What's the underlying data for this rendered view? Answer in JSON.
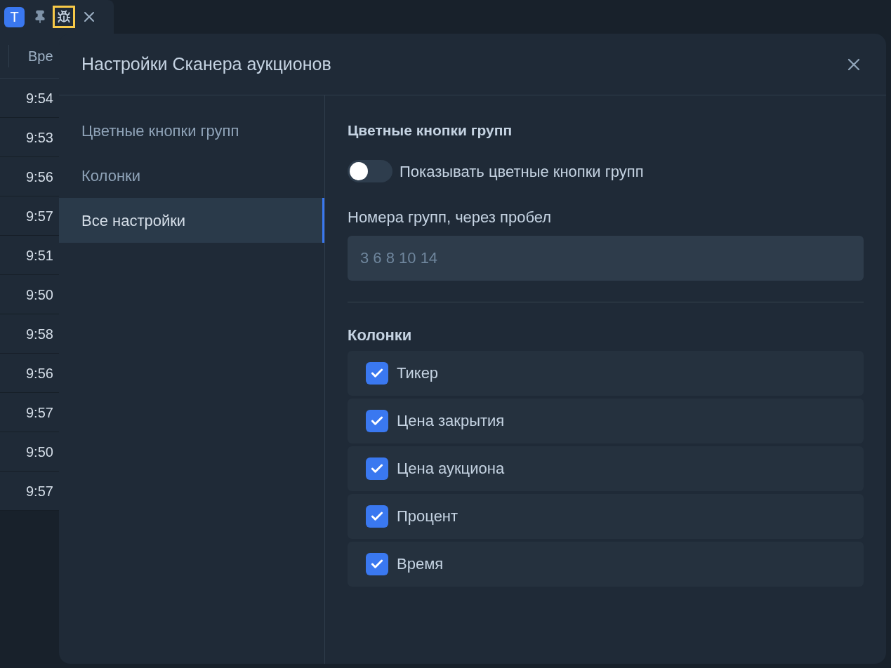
{
  "toolbar": {
    "badge": "T"
  },
  "table": {
    "column_header": "Вре",
    "rows": [
      "9:54",
      "9:53",
      "9:56",
      "9:57",
      "9:51",
      "9:50",
      "9:58",
      "9:56",
      "9:57",
      "9:50",
      "9:57"
    ]
  },
  "dialog": {
    "title": "Настройки Сканера аукционов",
    "sidebar": {
      "items": [
        {
          "label": "Цветные кнопки групп",
          "selected": false
        },
        {
          "label": "Колонки",
          "selected": false
        },
        {
          "label": "Все настройки",
          "selected": true
        }
      ]
    },
    "group_section": {
      "heading": "Цветные кнопки групп",
      "toggle": {
        "label": "Показывать цветные кнопки групп",
        "on": false
      },
      "field_label": "Номера групп, через пробел",
      "field": {
        "placeholder": "3 6 8 10 14"
      }
    },
    "columns_section": {
      "heading": "Колонки",
      "items": [
        {
          "label": "Тикер",
          "checked": true
        },
        {
          "label": "Цена закрытия",
          "checked": true
        },
        {
          "label": "Цена аукциона",
          "checked": true
        },
        {
          "label": "Процент",
          "checked": true
        },
        {
          "label": "Время",
          "checked": true
        }
      ]
    }
  }
}
